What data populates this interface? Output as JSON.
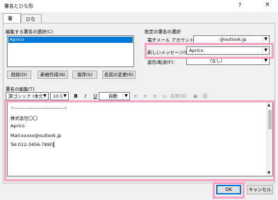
{
  "window": {
    "title": "署名とひな形",
    "help": "?",
    "close": "×"
  },
  "tabs": [
    {
      "label": "署名"
    },
    {
      "label": "ひな形"
    }
  ],
  "left": {
    "list_label": "編集する署名の選択(C)",
    "items": [
      "Aprico"
    ],
    "buttons": {
      "delete": "削除(D)",
      "new": "新規作成(N)",
      "save": "保存(S)",
      "rename": "名前の変更(R)"
    }
  },
  "right": {
    "section_label": "既定の署名の選択",
    "email_label": "電子メール アカウント(A):",
    "email_value": "@outlook.jp",
    "new_msg_label": "新しいメッセージ(M):",
    "new_msg_value": "Aprico",
    "reply_label": "返信/転送(F):",
    "reply_value": "(なし)"
  },
  "editor": {
    "label": "署名の編集(T)",
    "font": "游ゴシック (本文",
    "size": "10.5",
    "bold": "B",
    "italic": "I",
    "underline": "U",
    "color": "自動",
    "card": "名刺(B)",
    "lines": [
      "☆------------------------------☆",
      "株式会社〇〇",
      "Aprico",
      "Mail:xxxxx@outlook.jp",
      "Tel:012-3456-7890"
    ]
  },
  "footer": {
    "ok": "OK",
    "cancel": "キャンセル"
  },
  "highlight_color": "#f5a3c4",
  "selection_color": "#0078d7"
}
